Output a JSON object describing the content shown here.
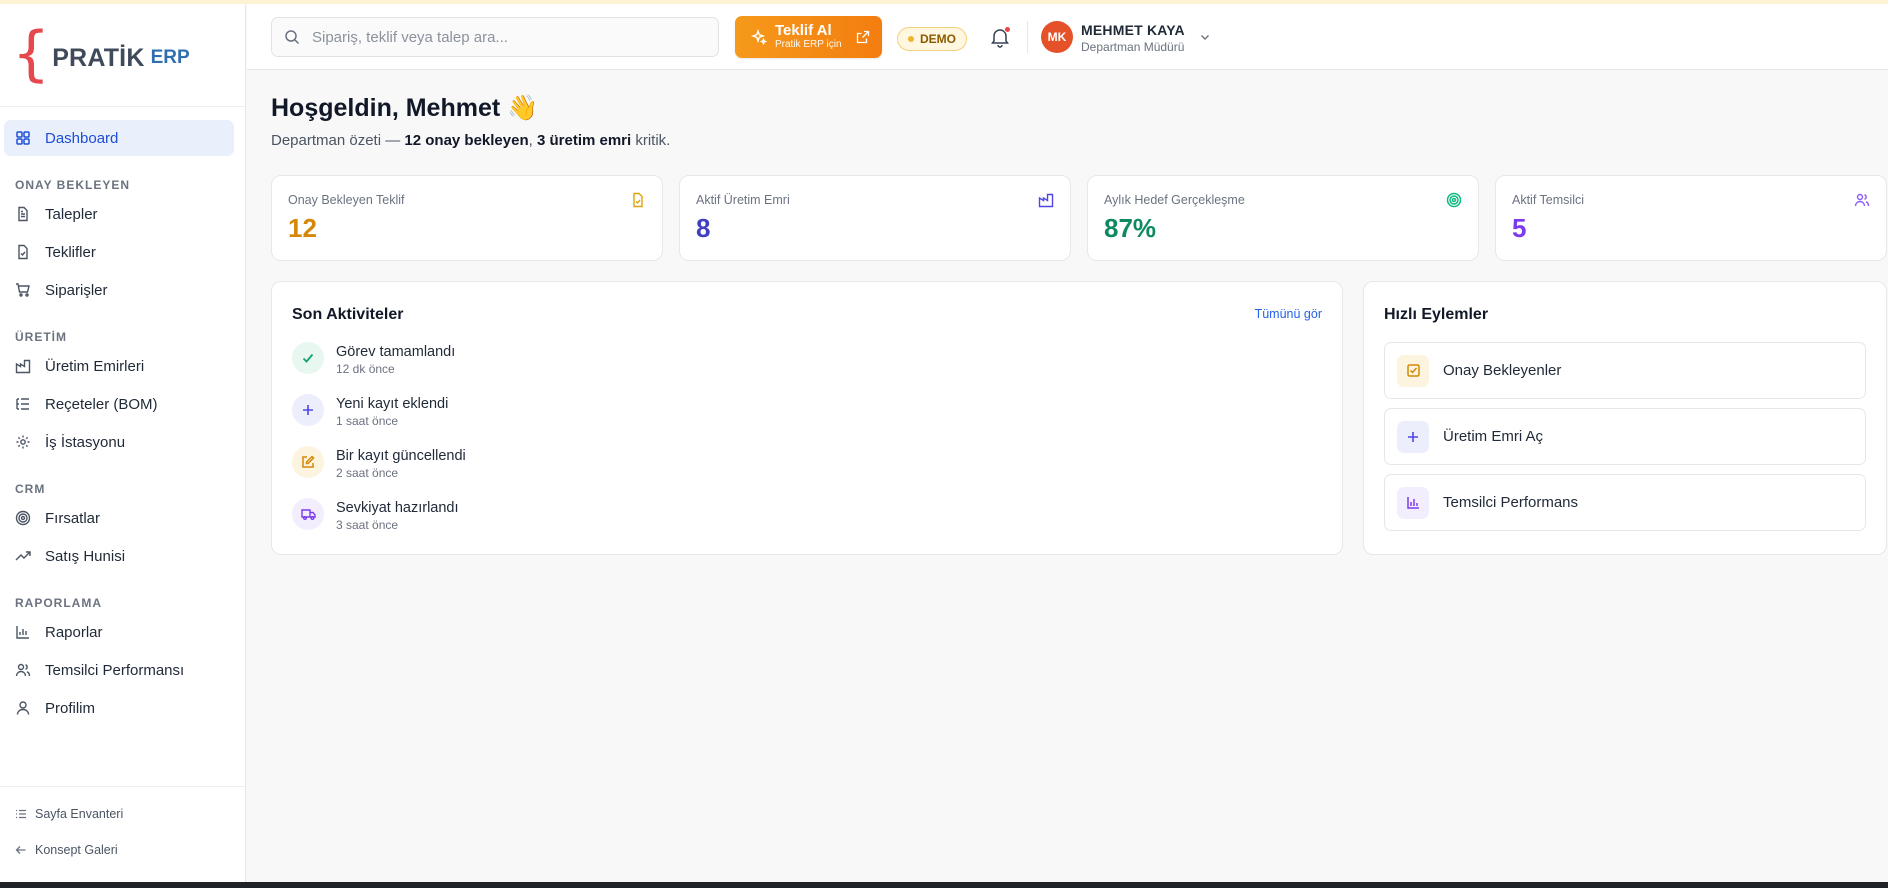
{
  "brand": {
    "name": "PRATİK",
    "suffix": "ERP"
  },
  "sidebar": {
    "dashboard": "Dashboard",
    "sections": [
      {
        "title": "ONAY BEKLEYEN",
        "items": [
          "Talepler",
          "Teklifler",
          "Siparişler"
        ]
      },
      {
        "title": "ÜRETİM",
        "items": [
          "Üretim Emirleri",
          "Reçeteler (BOM)",
          "İş İstasyonu"
        ]
      },
      {
        "title": "CRM",
        "items": [
          "Fırsatlar",
          "Satış Hunisi"
        ]
      },
      {
        "title": "RAPORLAMA",
        "items": [
          "Raporlar",
          "Temsilci Performansı",
          "Profilim"
        ]
      }
    ],
    "footer": [
      "Sayfa Envanteri",
      "Konsept Galeri"
    ]
  },
  "header": {
    "search_placeholder": "Sipariş, teklif veya talep ara...",
    "teklif_title": "Teklif Al",
    "teklif_sub": "Pratik ERP için",
    "demo": "DEMO",
    "user_initials": "MK",
    "user_name": "MEHMET KAYA",
    "user_role": "Departman Müdürü"
  },
  "greeting": {
    "title": "Hoşgeldin, Mehmet 👋",
    "sub_prefix": "Departman özeti — ",
    "sub_b1": "12 onay bekleyen",
    "sub_mid": ", ",
    "sub_b2": "3 üretim emri",
    "sub_suffix": " kritik."
  },
  "stats": [
    {
      "label": "Onay Bekleyen Teklif",
      "value": "12",
      "color": "#d48806",
      "icon": "document-icon"
    },
    {
      "label": "Aktif Üretim Emri",
      "value": "8",
      "color": "#3f3fbf",
      "icon": "factory-icon"
    },
    {
      "label": "Aylık Hedef Gerçekleşme",
      "value": "87%",
      "color": "#0f8a5f",
      "icon": "target-icon"
    },
    {
      "label": "Aktif Temsilci",
      "value": "5",
      "color": "#7c3aed",
      "icon": "users-icon"
    }
  ],
  "activities": {
    "title": "Son Aktiviteler",
    "see_all": "Tümünü gör",
    "items": [
      {
        "text": "Görev tamamlandı",
        "time": "12 dk önce",
        "icon": "check-icon"
      },
      {
        "text": "Yeni kayıt eklendi",
        "time": "1 saat önce",
        "icon": "plus-icon"
      },
      {
        "text": "Bir kayıt güncellendi",
        "time": "2 saat önce",
        "icon": "edit-icon"
      },
      {
        "text": "Sevkiyat hazırlandı",
        "time": "3 saat önce",
        "icon": "truck-icon"
      }
    ]
  },
  "quick": {
    "title": "Hızlı Eylemler",
    "items": [
      {
        "label": "Onay Bekleyenler",
        "icon": "checkbox-icon"
      },
      {
        "label": "Üretim Emri Aç",
        "icon": "plus-icon"
      },
      {
        "label": "Temsilci Performans",
        "icon": "bar-chart-icon"
      }
    ]
  }
}
